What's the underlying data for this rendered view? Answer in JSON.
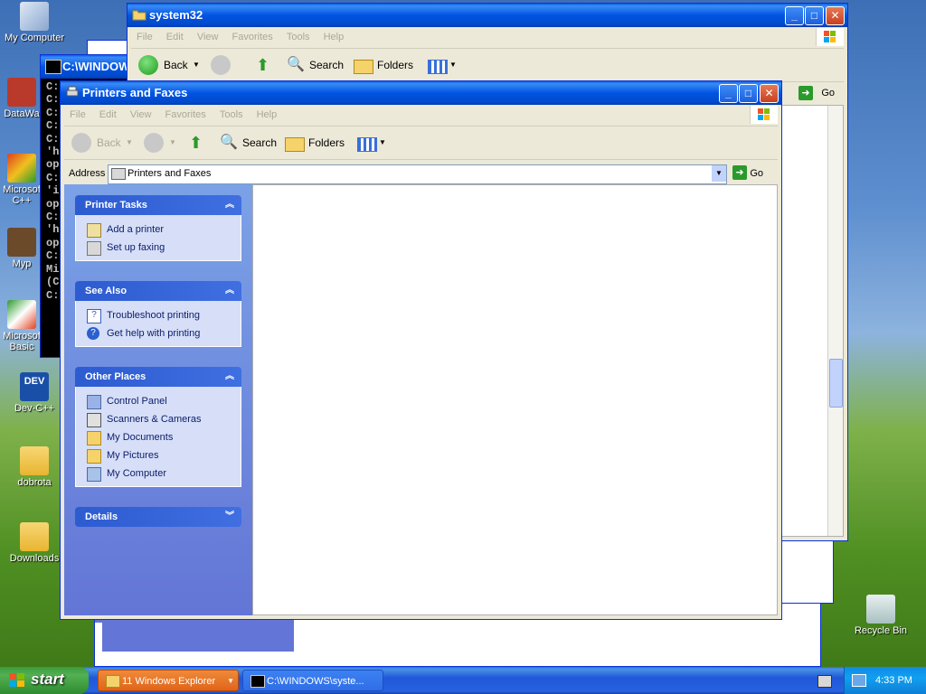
{
  "desktop": {
    "icons": [
      {
        "label": "My Computer"
      },
      {
        "label": "DataWa"
      },
      {
        "label": "Microsof C++"
      },
      {
        "label": "Myp"
      },
      {
        "label": "Microsof Basic"
      },
      {
        "label": "Dev-C++"
      },
      {
        "label": "dobrota"
      },
      {
        "label": "Downloads"
      },
      {
        "label": "Recycle Bin"
      }
    ]
  },
  "cmd_window": {
    "title": "C:\\WINDOW",
    "lines": [
      "C:",
      "C:",
      "C:",
      "C:",
      "C:",
      "'h",
      "op",
      "C:",
      "'i",
      "op",
      "C:",
      "'h",
      "op",
      "C:",
      "Mi",
      "(C",
      "C:"
    ]
  },
  "system32_window": {
    "title": "system32",
    "menu": [
      "File",
      "Edit",
      "View",
      "Favorites",
      "Tools",
      "Help"
    ],
    "toolbar": {
      "back": "Back",
      "search": "Search",
      "folders": "Folders"
    },
    "go_label": "Go"
  },
  "printers_window": {
    "title": "Printers and Faxes",
    "menu": [
      "File",
      "Edit",
      "View",
      "Favorites",
      "Tools",
      "Help"
    ],
    "toolbar": {
      "back": "Back",
      "search": "Search",
      "folders": "Folders"
    },
    "address_label": "Address",
    "address_value": "Printers and Faxes",
    "go_label": "Go",
    "panels": [
      {
        "title": "Printer Tasks",
        "links": [
          "Add a printer",
          "Set up faxing"
        ]
      },
      {
        "title": "See Also",
        "links": [
          "Troubleshoot printing",
          "Get help with printing"
        ]
      },
      {
        "title": "Other Places",
        "links": [
          "Control Panel",
          "Scanners & Cameras",
          "My Documents",
          "My Pictures",
          "My Computer"
        ]
      },
      {
        "title": "Details",
        "links": []
      }
    ]
  },
  "taskbar": {
    "start_label": "start",
    "tasks": [
      {
        "label": "11 Windows Explorer"
      },
      {
        "label": "C:\\WINDOWS\\syste..."
      }
    ],
    "clock": "4:33 PM"
  },
  "colors": {
    "xp_blue": "#0054e3",
    "task_panel": "#6375d6",
    "start_green": "#3c9a3c"
  }
}
